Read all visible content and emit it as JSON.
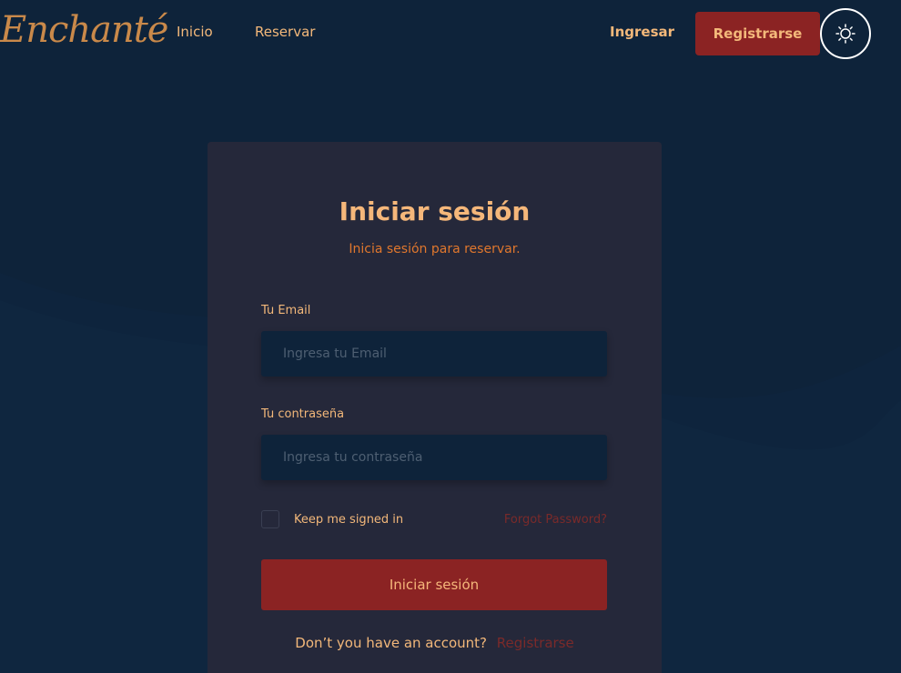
{
  "nav": {
    "logo": "Enchanté",
    "links": [
      {
        "label": "Inicio"
      },
      {
        "label": "Reservar"
      }
    ],
    "login_label": "Ingresar",
    "register_label": "Registrarse",
    "theme_icon": "sun-icon"
  },
  "card": {
    "title": "Iniciar sesión",
    "subtitle": "Inicia sesión para reservar.",
    "email_label": "Tu Email",
    "email_placeholder": "Ingresa tu Email",
    "password_label": "Tu contraseña",
    "password_placeholder": "Ingresa tu contraseña",
    "remember_label": "Keep me signed in",
    "forgot_label": "Forgot Password?",
    "submit_label": "Iniciar sesión",
    "no_account_text": "Don’t you have an account?",
    "signup_link": "Registrarse"
  },
  "colors": {
    "background": "#0e233a",
    "card": "#25283a",
    "accent": "#8b2323",
    "text": "#f3b87a"
  }
}
